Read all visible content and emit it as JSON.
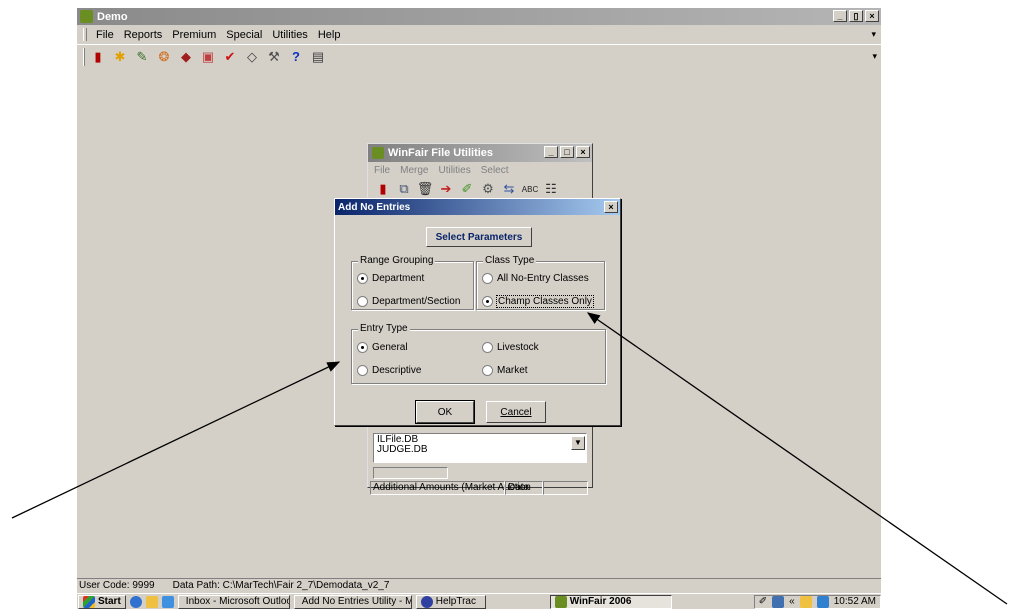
{
  "app": {
    "title": "Demo",
    "menu": [
      "File",
      "Reports",
      "Premium",
      "Special",
      "Utilities",
      "Help"
    ],
    "window_buttons": [
      "_",
      "▯",
      "×"
    ],
    "toolbar_icons": [
      "exit-icon",
      "runner-icon",
      "pencil-icon",
      "ribbon-icon",
      "cow-icon",
      "certificate-icon",
      "checkmark-icon",
      "tag-icon",
      "tools-icon",
      "help-icon",
      "report-icon"
    ]
  },
  "file_utilities": {
    "title": "WinFair File Utilities",
    "menu": [
      "File",
      "Merge",
      "Utilities",
      "Select"
    ],
    "list_items": [
      "ILFile.DB",
      "JUDGE.DB"
    ],
    "status": [
      "Additional Amounts (Market Auction",
      "Data",
      ""
    ]
  },
  "dialog": {
    "title": "Add No Entries",
    "close": "×",
    "params_button": "Select Parameters",
    "range_grouping": {
      "legend": "Range Grouping",
      "options": [
        "Department",
        "Department/Section"
      ],
      "selected": 0
    },
    "class_type": {
      "legend": "Class Type",
      "options": [
        "All No-Entry Classes",
        "Champ Classes Only"
      ],
      "selected": 1
    },
    "entry_type": {
      "legend": "Entry Type",
      "options": [
        "General",
        "Livestock",
        "Descriptive",
        "Market"
      ],
      "selected": 0
    },
    "ok": "OK",
    "cancel": "Cancel"
  },
  "statusbar": {
    "user_code": "User Code: 9999",
    "data_path": "Data Path:  C:\\MarTech\\Fair 2_7\\Demodata_v2_7"
  },
  "taskbar": {
    "start": "Start",
    "items": [
      "Inbox - Microsoft Outlook",
      "Add No Entries Utility - M...",
      "HelpTrac",
      "WinFair 2006"
    ],
    "active_index": 3,
    "clock": "10:52 AM"
  }
}
